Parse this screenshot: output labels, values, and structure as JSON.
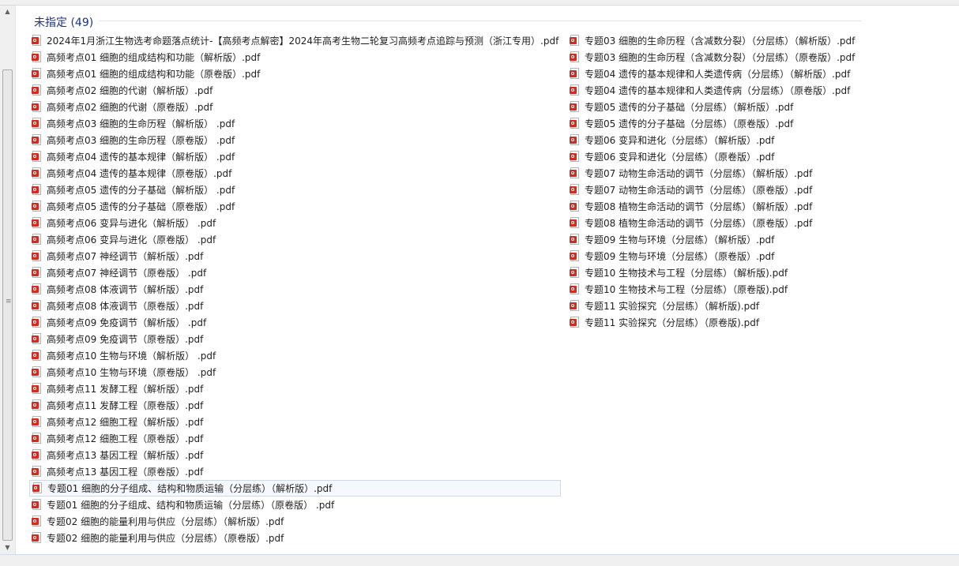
{
  "group": {
    "title": "未指定 (49)"
  },
  "left_items": [
    "2024年1月浙江生物选考命题落点统计-【高频考点解密】2024年高考生物二轮复习高频考点追踪与预测（浙江专用）.pdf",
    "高频考点01 细胞的组成结构和功能（解析版）.pdf",
    "高频考点01 细胞的组成结构和功能（原卷版）.pdf",
    "高频考点02 细胞的代谢（解析版）.pdf",
    "高频考点02 细胞的代谢（原卷版）.pdf",
    "高频考点03 细胞的生命历程（解析版） .pdf",
    "高频考点03 细胞的生命历程（原卷版） .pdf",
    "高频考点04 遗传的基本规律（解析版） .pdf",
    "高频考点04 遗传的基本规律（原卷版）.pdf",
    "高频考点05 遗传的分子基础（解析版） .pdf",
    "高频考点05 遗传的分子基础（原卷版） .pdf",
    "高频考点06 变异与进化（解析版）  .pdf",
    "高频考点06 变异与进化（原卷版）  .pdf",
    "高频考点07 神经调节（解析版）.pdf",
    "高频考点07 神经调节（原卷版） .pdf",
    "高频考点08 体液调节（解析版）.pdf",
    "高频考点08 体液调节（原卷版）.pdf",
    "高频考点09 免疫调节（解析版）  .pdf",
    "高频考点09 免疫调节（原卷版）.pdf",
    "高频考点10 生物与环境（解析版）  .pdf",
    "高频考点10 生物与环境（原卷版）   .pdf",
    "高频考点11 发酵工程（解析版）.pdf",
    "高频考点11 发酵工程（原卷版）.pdf",
    "高频考点12 细胞工程（解析版）.pdf",
    "高频考点12 细胞工程（原卷版）.pdf",
    "高频考点13 基因工程（解析版）.pdf",
    "高频考点13 基因工程（原卷版）.pdf",
    "专题01 细胞的分子组成、结构和物质运输（分层练）（解析版）.pdf",
    "专题01 细胞的分子组成、结构和物质运输（分层练）（原卷版） .pdf",
    "专题02 细胞的能量利用与供应（分层练）（解析版）.pdf",
    "专题02 细胞的能量利用与供应（分层练）（原卷版）.pdf"
  ],
  "right_items": [
    "专题03 细胞的生命历程（含减数分裂）（分层练）（解析版）.pdf",
    "专题03 细胞的生命历程（含减数分裂）（分层练）（原卷版）.pdf",
    "专题04 遗传的基本规律和人类遗传病（分层练）（解析版）.pdf",
    "专题04 遗传的基本规律和人类遗传病（分层练）（原卷版）.pdf",
    "专题05 遗传的分子基础（分层练）（解析版）.pdf",
    "专题05 遗传的分子基础（分层练）（原卷版）.pdf",
    "专题06 变异和进化（分层练）（解析版）.pdf",
    "专题06 变异和进化（分层练）（原卷版）.pdf",
    "专题07 动物生命活动的调节（分层练）（解析版）.pdf",
    "专题07 动物生命活动的调节（分层练）（原卷版）.pdf",
    "专题08 植物生命活动的调节（分层练）（解析版）.pdf",
    "专题08 植物生命活动的调节（分层练）（原卷版）.pdf",
    "专题09 生物与环境（分层练）（解析版）.pdf",
    "专题09 生物与环境（分层练）（原卷版）.pdf",
    "专题10 生物技术与工程（分层练）（解析版).pdf",
    "专题10 生物技术与工程（分层练）（原卷版).pdf",
    "专题11 实验探究（分层练）（解析版).pdf",
    "专题11 实验探究（分层练）（原卷版).pdf"
  ],
  "selected_index_left": 27,
  "icon": {
    "name": "pdf-file-icon",
    "color": "#d42b20"
  }
}
